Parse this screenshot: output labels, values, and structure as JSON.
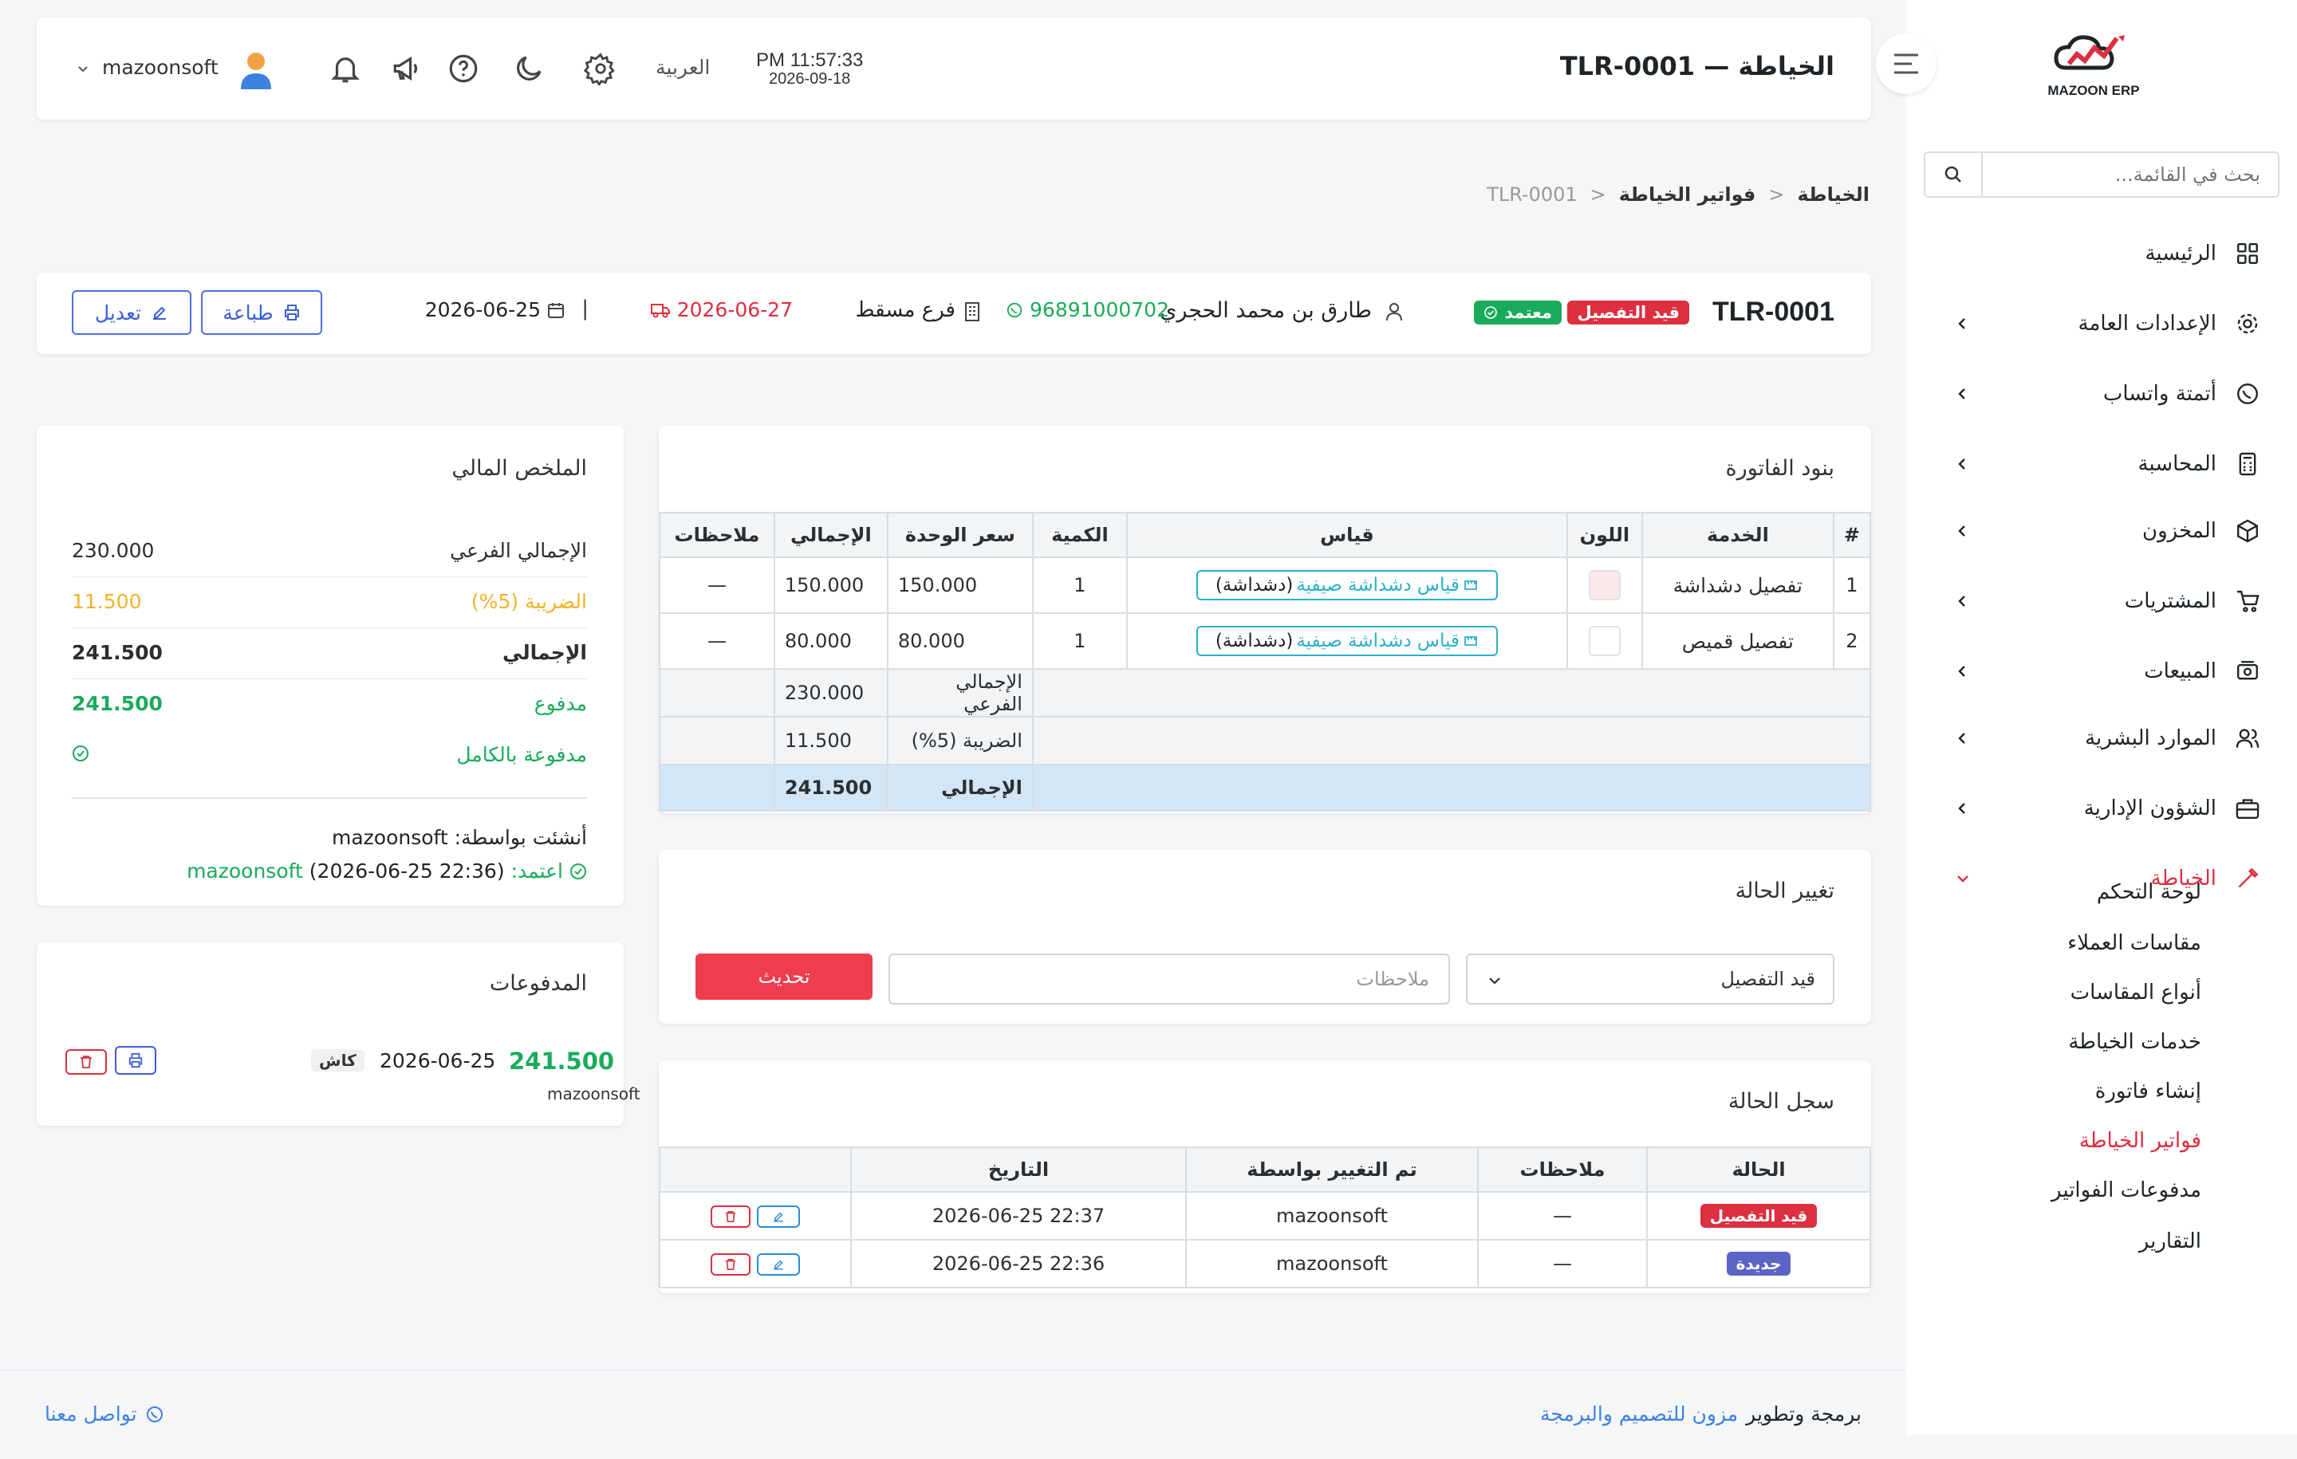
{
  "brand": {
    "logo_top": "ERP.ERP",
    "logo_text": "MAZOON ERP"
  },
  "sidebar": {
    "search_placeholder": "بحث في القائمة...",
    "items": [
      {
        "label": "الرئيسية",
        "icon": "grid-icon"
      },
      {
        "label": "الإعدادات العامة",
        "icon": "gear-icon"
      },
      {
        "label": "أتمتة واتساب",
        "icon": "whatsapp-icon"
      },
      {
        "label": "المحاسبة",
        "icon": "calculator-icon"
      },
      {
        "label": "المخزون",
        "icon": "box-icon"
      },
      {
        "label": "المشتريات",
        "icon": "cart-icon"
      },
      {
        "label": "المبيعات",
        "icon": "cash-icon"
      },
      {
        "label": "الموارد البشرية",
        "icon": "users-icon"
      },
      {
        "label": "الشؤون الإدارية",
        "icon": "briefcase-icon"
      },
      {
        "label": "الخياطة",
        "icon": "tailoring-icon"
      }
    ],
    "sub_items": [
      "لوحة التحكم",
      "مقاسات العملاء",
      "أنواع المقاسات",
      "خدمات الخياطة",
      "إنشاء فاتورة",
      "فواتير الخياطة",
      "مدفوعات الفواتير",
      "التقارير"
    ],
    "active_sub": "فواتير الخياطة"
  },
  "header": {
    "page_title": "الخياطة — TLR-0001",
    "time": "PM 11:57:33",
    "date": "2026-09-18",
    "language": "العربية",
    "username": "mazoonsoft"
  },
  "breadcrumb": {
    "items": [
      "الخياطة",
      "فواتير الخياطة",
      "TLR-0001"
    ]
  },
  "invoice": {
    "number": "TLR-0001",
    "status_badge": "قيد التفصيل",
    "approved_badge": "معتمد",
    "customer": "طارق بن محمد الحجري",
    "phone": "96891000702",
    "branch": "فرع مسقط",
    "due_date": "2026-06-27",
    "separator": "|",
    "date": "2026-06-25",
    "print_label": "طباعة",
    "edit_label": "تعديل"
  },
  "items_card": {
    "title": "بنود الفاتورة",
    "columns": [
      "#",
      "الخدمة",
      "اللون",
      "قياس",
      "الكمية",
      "سعر الوحدة",
      "الإجمالي",
      "ملاحظات"
    ],
    "rows": [
      {
        "num": "1",
        "service": "تفصيل دشداشة",
        "color_hex": "#fde8ea",
        "measure_link": "قياس دشداشة صيفية",
        "measure_type": "(دشداشة)",
        "qty": "1",
        "unit_price": "150.000",
        "total": "150.000",
        "notes": "—"
      },
      {
        "num": "2",
        "service": "تفصيل قميص",
        "color_hex": "#ffffff",
        "measure_link": "قياس دشداشة صيفية",
        "measure_type": "(دشداشة)",
        "qty": "1",
        "unit_price": "80.000",
        "total": "80.000",
        "notes": "—"
      }
    ],
    "subtotal_label": "الإجمالي الفرعي",
    "subtotal_value": "230.000",
    "tax_label": "الضريبة (5%)",
    "tax_value": "11.500",
    "total_label": "الإجمالي",
    "total_value": "241.500"
  },
  "status_change": {
    "title": "تغيير الحالة",
    "selected": "قيد التفصيل",
    "notes_placeholder": "ملاحظات",
    "update_label": "تحديث"
  },
  "status_log": {
    "title": "سجل الحالة",
    "columns": [
      "الحالة",
      "ملاحظات",
      "تم التغيير بواسطة",
      "التاريخ"
    ],
    "rows": [
      {
        "status": "قيد التفصيل",
        "status_color": "#dc2f3f",
        "notes": "—",
        "by": "mazoonsoft",
        "date": "2026-06-25 22:37"
      },
      {
        "status": "جديدة",
        "status_color": "#5b64c4",
        "notes": "—",
        "by": "mazoonsoft",
        "date": "2026-06-25 22:36"
      }
    ]
  },
  "summary": {
    "title": "الملخص المالي",
    "subtotal_label": "الإجمالي الفرعي",
    "subtotal_value": "230.000",
    "tax_label": "الضريبة (5%)",
    "tax_value": "11.500",
    "total_label": "الإجمالي",
    "total_value": "241.500",
    "paid_label": "مدفوع",
    "paid_value": "241.500",
    "paid_status": "مدفوعة بالكامل",
    "created_by": "أنشئت بواسطة: mazoonsoft",
    "approved_label": "اعتمد:",
    "approved_user": "mazoonsoft",
    "approved_time": "(2026-06-25 22:36)"
  },
  "payments": {
    "title": "المدفوعات",
    "amount": "241.500",
    "date": "2026-06-25",
    "method": "كاش",
    "user": "mazoonsoft"
  },
  "footer": {
    "credit_prefix": "برمجة وتطوير",
    "credit_link": "مزون للتصميم والبرمجة",
    "contact": "تواصل معنا"
  },
  "colors": {
    "accent": "#dc2f3f",
    "success": "#1aab5c",
    "warning": "#f0b429",
    "primary": "#3d5fd6",
    "link": "#2cb0c9"
  }
}
